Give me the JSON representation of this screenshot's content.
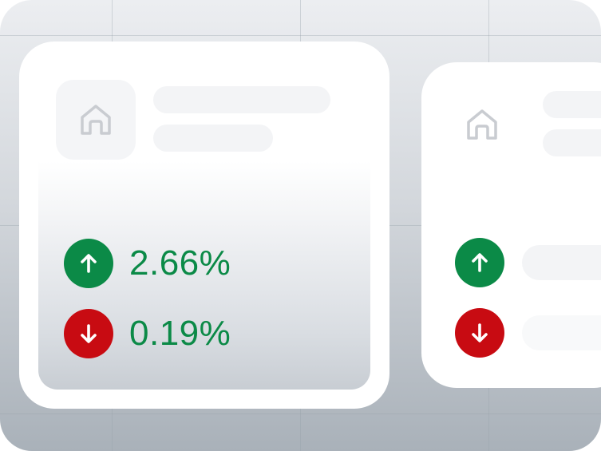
{
  "main_card": {
    "icon": "home-icon",
    "stats": [
      {
        "direction": "up",
        "icon": "arrow-up-icon",
        "value": "2.66%"
      },
      {
        "direction": "down",
        "icon": "arrow-down-icon",
        "value": "0.19%"
      }
    ]
  },
  "side_card": {
    "icon": "home-icon",
    "stats": [
      {
        "direction": "up",
        "icon": "arrow-up-icon"
      },
      {
        "direction": "down",
        "icon": "arrow-down-icon"
      }
    ]
  },
  "colors": {
    "positive": "#0b8a47",
    "negative": "#c80b12",
    "placeholder": "#f3f4f6"
  }
}
